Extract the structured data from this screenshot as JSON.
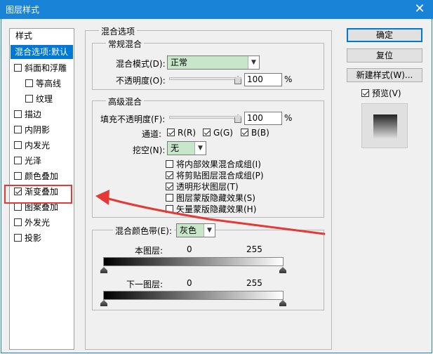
{
  "window": {
    "title": "图层样式",
    "close_label": "✕"
  },
  "sidebar": {
    "header": "样式",
    "selected": "混合选项:默认",
    "items": [
      {
        "label": "斜面和浮雕",
        "checked": false
      },
      {
        "label": "等高线",
        "checked": false
      },
      {
        "label": "纹理",
        "checked": false
      },
      {
        "label": "描边",
        "checked": false
      },
      {
        "label": "内阴影",
        "checked": false
      },
      {
        "label": "内发光",
        "checked": false
      },
      {
        "label": "光泽",
        "checked": false
      },
      {
        "label": "颜色叠加",
        "checked": false
      },
      {
        "label": "渐变叠加",
        "checked": true
      },
      {
        "label": "图案叠加",
        "checked": false
      },
      {
        "label": "外发光",
        "checked": false
      },
      {
        "label": "投影",
        "checked": false
      }
    ]
  },
  "blend_options": {
    "title": "混合选项",
    "general": {
      "title": "常规混合",
      "mode_label": "混合模式(D):",
      "mode_value": "正常",
      "opacity_label": "不透明度(O):",
      "opacity_value": "100",
      "opacity_unit": "%"
    },
    "advanced": {
      "title": "高级混合",
      "fill_label": "填充不透明度(F):",
      "fill_value": "100",
      "fill_unit": "%",
      "channels_label": "通道:",
      "channel_r": "R(R)",
      "channel_g": "G(G)",
      "channel_b": "B(B)",
      "knockout_label": "挖空(N):",
      "knockout_value": "无",
      "options": [
        {
          "label": "将内部效果混合成组(I)",
          "checked": false
        },
        {
          "label": "将剪贴图层混合成组(P)",
          "checked": true
        },
        {
          "label": "透明形状图层(T)",
          "checked": true
        },
        {
          "label": "图层蒙版隐藏效果(S)",
          "checked": false
        },
        {
          "label": "矢量蒙版隐藏效果(H)",
          "checked": false
        }
      ]
    },
    "blend_if": {
      "label": "混合颜色带(E):",
      "value": "灰色",
      "this_layer": "本图层:",
      "this_min": "0",
      "this_max": "255",
      "under_layer": "下一图层:",
      "under_min": "0",
      "under_max": "255"
    }
  },
  "buttons": {
    "ok": "确定",
    "reset": "复位",
    "new_style": "新建样式(W)...",
    "preview_label": "预览(V)"
  },
  "colors": {
    "titlebar": "#1883d7",
    "selection": "#0078d7",
    "annotation": "#e53935",
    "select_bg": "#c8e6c9"
  }
}
